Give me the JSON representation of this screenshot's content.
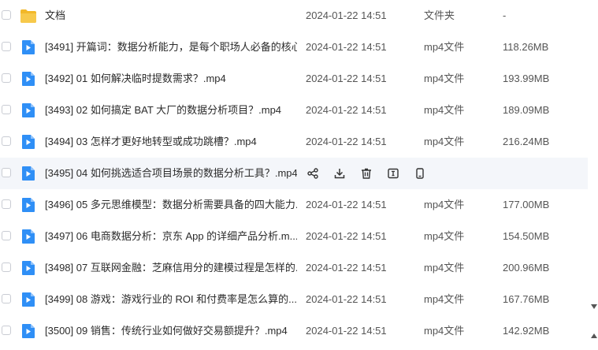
{
  "files": [
    {
      "name": "文档",
      "date": "2024-01-22 14:51",
      "type": "文件夹",
      "size": "-",
      "icon": "folder-icon"
    },
    {
      "name": "[3491] 开篇词：数据分析能力，是每个职场人必备的核心...",
      "date": "2024-01-22 14:51",
      "type": "mp4文件",
      "size": "118.26MB",
      "icon": "video-file-icon"
    },
    {
      "name": "[3492] 01  如何解决临时提数需求？.mp4",
      "date": "2024-01-22 14:51",
      "type": "mp4文件",
      "size": "193.99MB",
      "icon": "video-file-icon"
    },
    {
      "name": "[3493] 02  如何搞定 BAT 大厂的数据分析项目？.mp4",
      "date": "2024-01-22 14:51",
      "type": "mp4文件",
      "size": "189.09MB",
      "icon": "video-file-icon"
    },
    {
      "name": "[3494] 03  怎样才更好地转型或成功跳槽？.mp4",
      "date": "2024-01-22 14:51",
      "type": "mp4文件",
      "size": "216.24MB",
      "icon": "video-file-icon"
    },
    {
      "name": "[3495] 04  如何挑选适合项目场景的数据分析工具？.mp4",
      "date": "",
      "type": "",
      "size": "",
      "icon": "video-file-icon",
      "hover": true
    },
    {
      "name": "[3496] 05  多元思维模型：数据分析需要具备的四大能力...",
      "date": "2024-01-22 14:51",
      "type": "mp4文件",
      "size": "177.00MB",
      "icon": "video-file-icon"
    },
    {
      "name": "[3497] 06  电商数据分析：京东 App 的详细产品分析.m...",
      "date": "2024-01-22 14:51",
      "type": "mp4文件",
      "size": "154.50MB",
      "icon": "video-file-icon"
    },
    {
      "name": "[3498] 07  互联网金融：芝麻信用分的建模过程是怎样的...",
      "date": "2024-01-22 14:51",
      "type": "mp4文件",
      "size": "200.96MB",
      "icon": "video-file-icon"
    },
    {
      "name": "[3499] 08  游戏：游戏行业的 ROI 和付费率是怎么算的...",
      "date": "2024-01-22 14:51",
      "type": "mp4文件",
      "size": "167.76MB",
      "icon": "video-file-icon"
    },
    {
      "name": "[3500] 09  销售：传统行业如何做好交易额提升？.mp4",
      "date": "2024-01-22 14:51",
      "type": "mp4文件",
      "size": "142.92MB",
      "icon": "video-file-icon"
    }
  ],
  "hover_actions": [
    "share-icon",
    "download-icon",
    "delete-icon",
    "rename-icon",
    "mobile-icon"
  ],
  "colors": {
    "folder": "#f7c43d",
    "video": "#2f8ff6",
    "hover_bg": "#f4f6fa"
  }
}
